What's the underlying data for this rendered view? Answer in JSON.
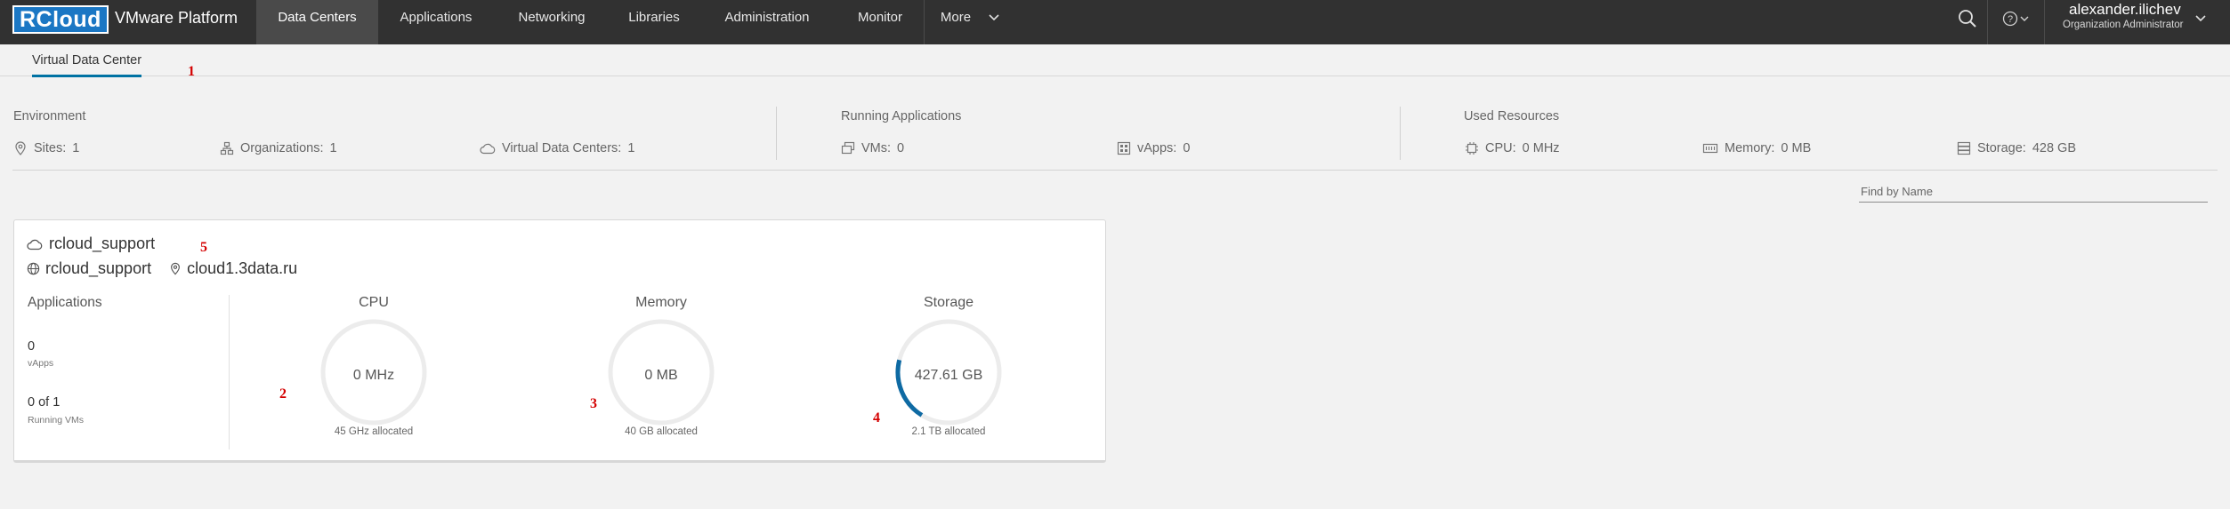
{
  "app": {
    "logo_text": "RCloud",
    "platform_title": "VMware Platform"
  },
  "nav": {
    "items": [
      {
        "label": "Data Centers",
        "active": true
      },
      {
        "label": "Applications"
      },
      {
        "label": "Networking"
      },
      {
        "label": "Libraries"
      },
      {
        "label": "Administration"
      },
      {
        "label": "Monitor"
      },
      {
        "label": "More"
      }
    ]
  },
  "user": {
    "name": "alexander.ilichev",
    "role": "Organization Administrator"
  },
  "subtabs": {
    "active": "Virtual Data Center"
  },
  "markers": [
    "1",
    "2",
    "3",
    "4",
    "5"
  ],
  "summary": {
    "environment": {
      "title": "Environment",
      "sites_label": "Sites:",
      "sites_value": "1",
      "orgs_label": "Organizations:",
      "orgs_value": "1",
      "vdcs_label": "Virtual Data Centers:",
      "vdcs_value": "1"
    },
    "running": {
      "title": "Running Applications",
      "vms_label": "VMs:",
      "vms_value": "0",
      "vapps_label": "vApps:",
      "vapps_value": "0"
    },
    "resources": {
      "title": "Used Resources",
      "cpu_label": "CPU:",
      "cpu_value": "0 MHz",
      "memory_label": "Memory:",
      "memory_value": "0 MB",
      "storage_label": "Storage:",
      "storage_value": "428 GB"
    }
  },
  "search": {
    "placeholder": "Find by Name",
    "value": ""
  },
  "vdc_card": {
    "name": "rcloud_support",
    "org": "rcloud_support",
    "site": "cloud1.3data.ru",
    "applications": {
      "title": "Applications",
      "vapps_value": "0",
      "vapps_caption": "vApps",
      "vms_value": "0 of 1",
      "vms_caption": "Running VMs"
    },
    "gauges": [
      {
        "title": "CPU",
        "value": "0 MHz",
        "caption": "45 GHz allocated",
        "fraction": 0
      },
      {
        "title": "Memory",
        "value": "0 MB",
        "caption": "40 GB allocated",
        "fraction": 0
      },
      {
        "title": "Storage",
        "value": "427.61 GB",
        "caption": "2.1 TB allocated",
        "fraction": 0.2
      }
    ]
  },
  "colors": {
    "nav_bg": "#313131",
    "accent": "#0072a3",
    "logo_bg": "#1b77c4",
    "gauge_track": "#ececec",
    "gauge_fill": "#0e6aa3",
    "marker": "#d40000"
  }
}
